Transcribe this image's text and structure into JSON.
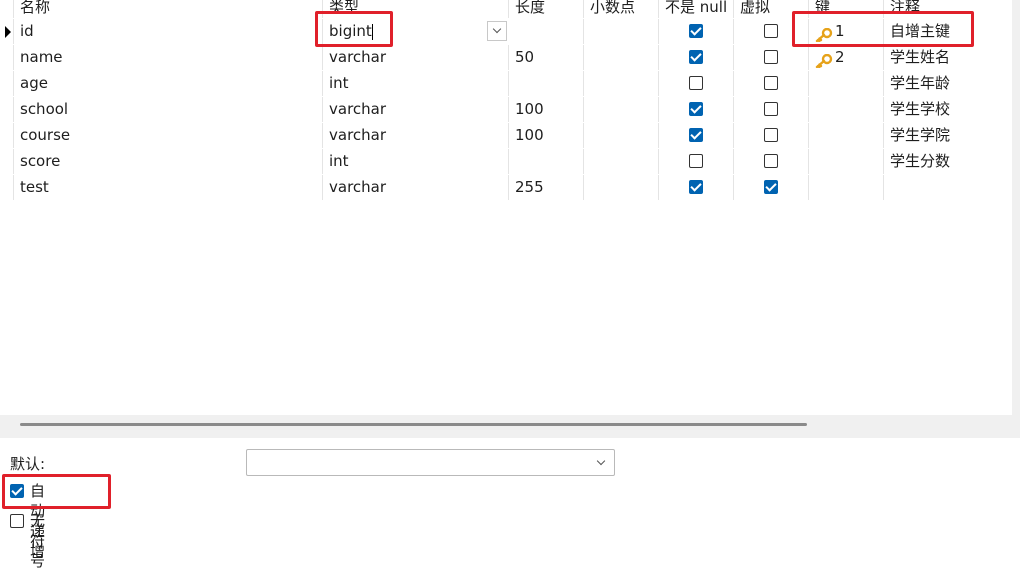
{
  "columns": {
    "name": "名称",
    "type": "类型",
    "length": "长度",
    "decimal": "小数点",
    "not_null": "不是 null",
    "virtual": "虚拟",
    "key": "键",
    "comment": "注释"
  },
  "rows": [
    {
      "name": "id",
      "type": "bigint",
      "length": "",
      "decimal": "",
      "not_null": true,
      "virtual": false,
      "key": "1",
      "comment": "自增主键"
    },
    {
      "name": "name",
      "type": "varchar",
      "length": "50",
      "decimal": "",
      "not_null": true,
      "virtual": false,
      "key": "2",
      "comment": "学生姓名"
    },
    {
      "name": "age",
      "type": "int",
      "length": "",
      "decimal": "",
      "not_null": false,
      "virtual": false,
      "key": "",
      "comment": "学生年龄"
    },
    {
      "name": "school",
      "type": "varchar",
      "length": "100",
      "decimal": "",
      "not_null": true,
      "virtual": false,
      "key": "",
      "comment": "学生学校"
    },
    {
      "name": "course",
      "type": "varchar",
      "length": "100",
      "decimal": "",
      "not_null": true,
      "virtual": false,
      "key": "",
      "comment": "学生学院"
    },
    {
      "name": "score",
      "type": "int",
      "length": "",
      "decimal": "",
      "not_null": false,
      "virtual": false,
      "key": "",
      "comment": "学生分数"
    },
    {
      "name": "test",
      "type": "varchar",
      "length": "255",
      "decimal": "",
      "not_null": true,
      "virtual": true,
      "key": "",
      "comment": ""
    }
  ],
  "icons": {
    "key": "key-icon",
    "row_pointer": "triangle-right-icon",
    "dropdown": "chevron-down-icon"
  },
  "colors": {
    "highlight": "#e0202a",
    "checkbox_on": "#0063b1",
    "key_icon": "#e6a21a"
  },
  "properties": {
    "default_label": "默认:",
    "default_value": "",
    "auto_increment_label": "自动递增",
    "auto_increment": true,
    "unsigned_label": "无符号",
    "unsigned": false
  }
}
